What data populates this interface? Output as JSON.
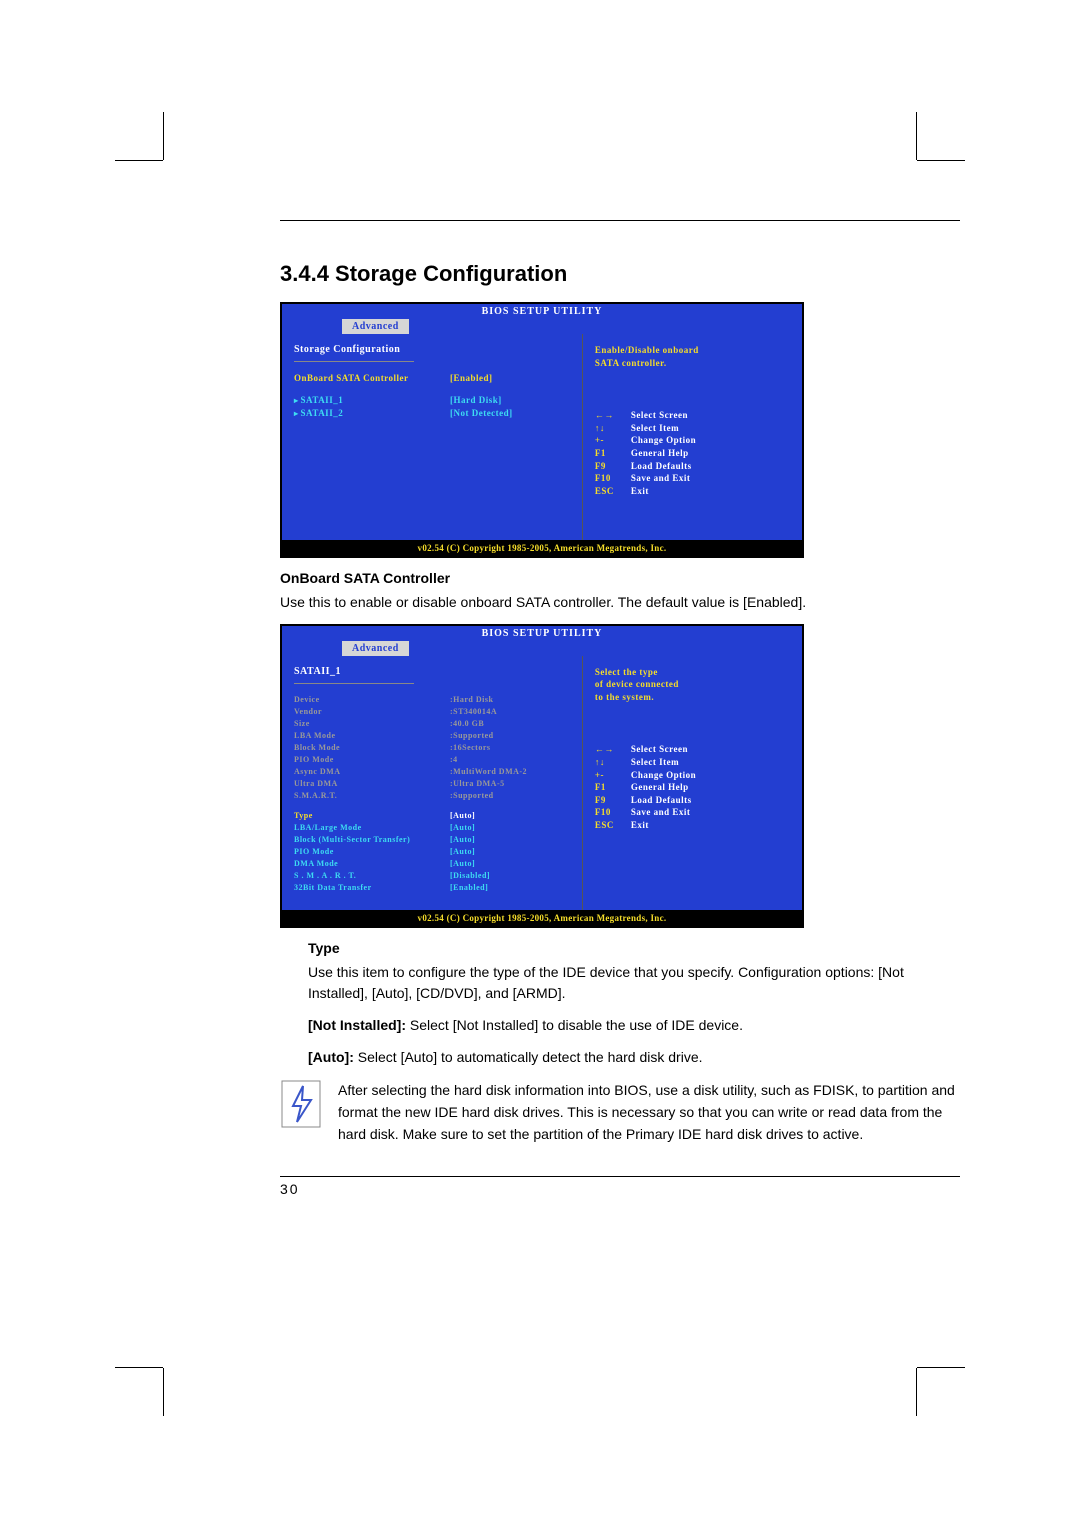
{
  "section_title": "3.4.4 Storage Configuration",
  "bios1": {
    "title": "BIOS SETUP UTILITY",
    "tab": "Advanced",
    "heading": "Storage Configuration",
    "rows": [
      {
        "label": "OnBoard SATA Controller",
        "val": "[Enabled]",
        "kind": "yellow"
      },
      {
        "label": "SATAII_1",
        "val": "[Hard Disk]",
        "kind": "cyan",
        "arrow": true
      },
      {
        "label": "SATAII_2",
        "val": "[Not Detected]",
        "kind": "cyan",
        "arrow": true
      }
    ],
    "help_lines": [
      "Enable/Disable onboard",
      "SATA controller."
    ],
    "footer": "v02.54 (C) Copyright 1985-2005, American Megatrends, Inc."
  },
  "controller_head": "OnBoard SATA Controller",
  "controller_body": "Use this to enable or disable onboard SATA controller. The default value is [Enabled].",
  "bios2": {
    "title": "BIOS SETUP UTILITY",
    "tab": "Advanced",
    "heading": "SATAII_1",
    "info_rows": [
      {
        "label": "Device",
        "val": ":Hard Disk"
      },
      {
        "label": "Vendor",
        "val": ":ST340014A"
      },
      {
        "label": "Size",
        "val": ":40.0 GB"
      },
      {
        "label": "LBA Mode",
        "val": ":Supported"
      },
      {
        "label": "Block Mode",
        "val": ":16Sectors"
      },
      {
        "label": "PIO Mode",
        "val": ":4"
      },
      {
        "label": "Async DMA",
        "val": ":MultiWord DMA-2"
      },
      {
        "label": "Ultra DMA",
        "val": ":Ultra DMA-5"
      },
      {
        "label": "S.M.A.R.T.",
        "val": ":Supported"
      }
    ],
    "opt_rows": [
      {
        "label": "Type",
        "val": "[Auto]",
        "sel": true
      },
      {
        "label": "LBA/Large Mode",
        "val": "[Auto]"
      },
      {
        "label": "Block (Multi-Sector Transfer)",
        "val": "[Auto]"
      },
      {
        "label": "PIO Mode",
        "val": "[Auto]"
      },
      {
        "label": "DMA Mode",
        "val": "[Auto]"
      },
      {
        "label": "S . M . A . R . T.",
        "val": "[Disabled]"
      },
      {
        "label": "32Bit Data Transfer",
        "val": "[Enabled]"
      }
    ],
    "help_lines": [
      "Select the type",
      "of device connected",
      "to the system."
    ],
    "footer": "v02.54 (C) Copyright 1985-2005, American Megatrends, Inc."
  },
  "navhelp": [
    {
      "k": "←→",
      "d": "Select Screen"
    },
    {
      "k": "↑↓",
      "d": "Select Item"
    },
    {
      "k": "+-",
      "d": "Change Option"
    },
    {
      "k": "F1",
      "d": "General Help"
    },
    {
      "k": "F9",
      "d": "Load Defaults"
    },
    {
      "k": "F10",
      "d": "Save and Exit"
    },
    {
      "k": "ESC",
      "d": "Exit"
    }
  ],
  "type_head": "Type",
  "type_p1": "Use this item to configure the type of the IDE device that you specify. Configuration options: [Not Installed], [Auto], [CD/DVD], and [ARMD].",
  "type_p2_b": "Not Installed]:",
  "type_p2": " Select [Not Installed] to disable the use of IDE device.",
  "type_p3_b": "[Auto]:",
  "type_p3": " Select [Auto] to automatically detect the hard disk drive.",
  "note": "After selecting the hard disk information into BIOS, use a disk utility, such as FDISK, to partition and format the new IDE hard disk drives. This is necessary so that you can write or read data from the hard disk. Make sure to set the partition of the Primary IDE hard disk drives to active.",
  "page_number": "30"
}
